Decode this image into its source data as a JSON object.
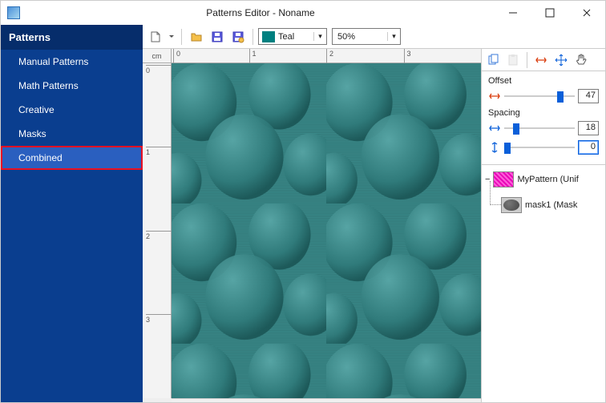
{
  "titlebar": {
    "title": "Patterns Editor - Noname"
  },
  "sidebar": {
    "title": "Patterns",
    "items": [
      {
        "label": "Manual Patterns"
      },
      {
        "label": "Math Patterns"
      },
      {
        "label": "Creative"
      },
      {
        "label": "Masks"
      },
      {
        "label": "Combined"
      }
    ]
  },
  "toolbar": {
    "color_name": "Teal",
    "color_hex": "#008080",
    "zoom": "50%"
  },
  "ruler": {
    "unit": "cm",
    "top": [
      "0",
      "1",
      "2",
      "3"
    ],
    "left": [
      "0",
      "1",
      "2",
      "3"
    ]
  },
  "panel": {
    "offset_label": "Offset",
    "offset_value": "47",
    "spacing_label": "Spacing",
    "spacing_h_value": "18",
    "spacing_v_value": "0"
  },
  "tree": {
    "root_label": "MyPattern (Unif",
    "child_label": "mask1 (Mask"
  }
}
